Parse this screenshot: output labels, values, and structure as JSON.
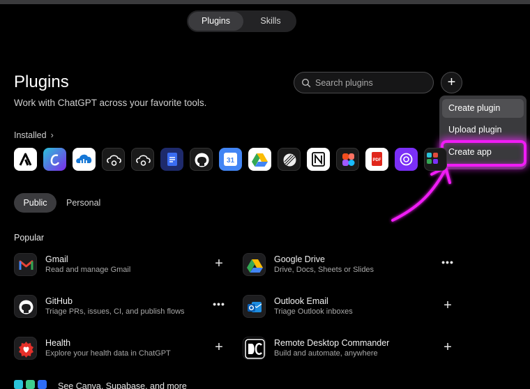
{
  "tabs": {
    "plugins": "Plugins",
    "skills": "Skills"
  },
  "header": {
    "title": "Plugins",
    "subtitle": "Work with ChatGPT across your favorite tools."
  },
  "search": {
    "placeholder": "Search plugins"
  },
  "add_button": "+",
  "dropdown": {
    "items": [
      "Create plugin",
      "Upload plugin",
      "Create app"
    ]
  },
  "installed": {
    "label": "Installed",
    "apps": [
      "acrobat",
      "canva",
      "cloud-service",
      "cloud-cat",
      "cloud-cat-2",
      "google-docs",
      "github",
      "calendar",
      "google-drive",
      "linear",
      "notion",
      "figma",
      "pdf",
      "openai",
      "more"
    ]
  },
  "filter_tabs": {
    "public": "Public",
    "personal": "Personal"
  },
  "popular": {
    "label": "Popular",
    "items": [
      {
        "name": "Gmail",
        "desc": "Read and manage Gmail",
        "icon": "gmail-icon",
        "action": "+"
      },
      {
        "name": "Google Drive",
        "desc": "Drive, Docs, Sheets or Slides",
        "icon": "google-drive-icon",
        "action": "•••"
      },
      {
        "name": "GitHub",
        "desc": "Triage PRs, issues, CI, and publish flows",
        "icon": "github-icon",
        "action": "•••"
      },
      {
        "name": "Outlook Email",
        "desc": "Triage Outlook inboxes",
        "icon": "outlook-icon",
        "action": "+"
      },
      {
        "name": "Health",
        "desc": "Explore your health data in ChatGPT",
        "icon": "health-icon",
        "action": "+"
      },
      {
        "name": "Remote Desktop Commander",
        "desc": "Build and automate, anywhere",
        "icon": "remote-desktop-icon",
        "action": "+"
      }
    ]
  },
  "see_more": "See Canva, Supabase, and more",
  "colors": {
    "highlight": "#f01cf5",
    "background": "#000000",
    "menu": "#3a3a3d"
  }
}
